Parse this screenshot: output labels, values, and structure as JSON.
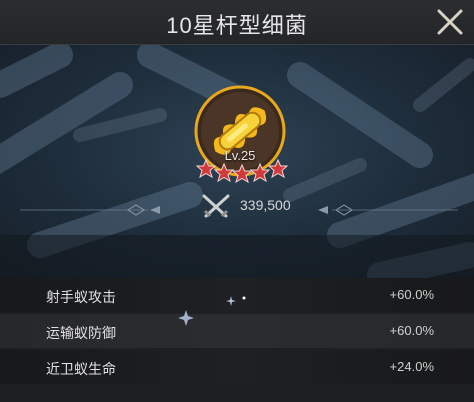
{
  "header": {
    "title": "10星杆型细菌",
    "close_icon": "close-x-icon"
  },
  "hero": {
    "emblem_icon": "bacillus-emblem-icon",
    "level": "Lv.25",
    "star_count": 5,
    "star_color": "#d23a3a",
    "emblem_color": "#e8a81a",
    "power_icon": "crossed-swords-icon",
    "power": "339,500"
  },
  "stats": [
    {
      "name": "射手蚁攻击",
      "value": "+60.0%"
    },
    {
      "name": "运输蚁防御",
      "value": "+60.0%"
    },
    {
      "name": "近卫蚁生命",
      "value": "+24.0%"
    }
  ]
}
